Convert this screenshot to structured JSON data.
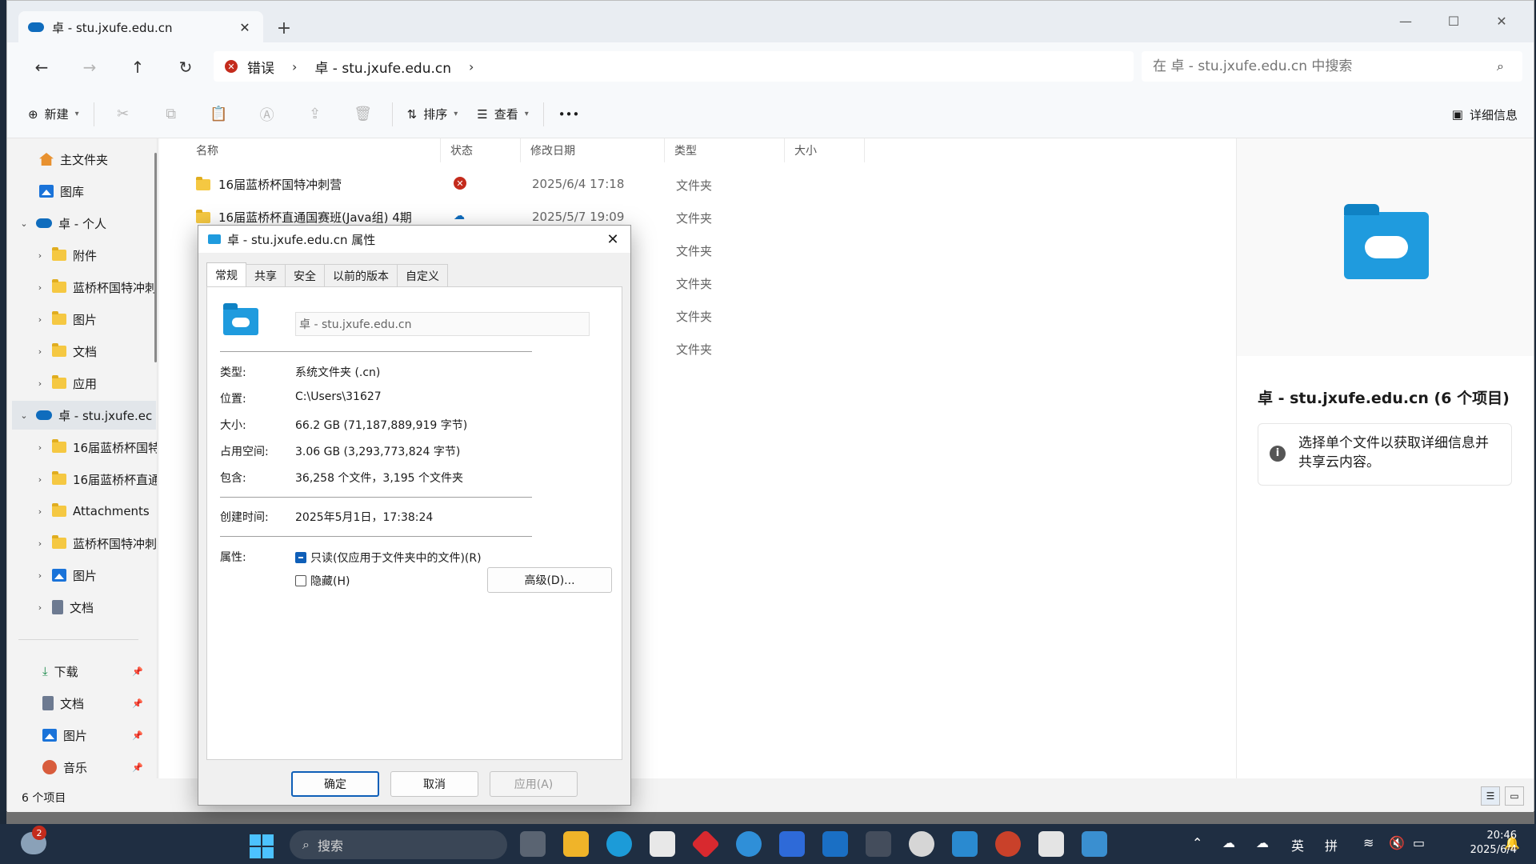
{
  "tab": {
    "title": "卓 - stu.jxufe.edu.cn"
  },
  "address": {
    "error_label": "错误",
    "location": "卓 - stu.jxufe.edu.cn"
  },
  "search": {
    "placeholder": "在 卓 - stu.jxufe.edu.cn 中搜索"
  },
  "toolbar": {
    "new_label": "新建",
    "sort_label": "排序",
    "view_label": "查看",
    "more_label": "•••",
    "details_label": "详细信息"
  },
  "sidebar": {
    "home": "主文件夹",
    "gallery": "图库",
    "personal": "卓 - 个人",
    "personal_children": [
      "附件",
      "蓝桥杯国特冲刺",
      "图片",
      "文档",
      "应用"
    ],
    "org": "卓 - stu.jxufe.ec",
    "org_children": [
      "16届蓝桥杯国特",
      "16届蓝桥杯直通",
      "Attachments",
      "蓝桥杯国特冲刺",
      "图片",
      "文档"
    ],
    "quick": [
      "下载",
      "文档",
      "图片",
      "音乐"
    ]
  },
  "columns": {
    "name": "名称",
    "status": "状态",
    "modified": "修改日期",
    "type": "类型",
    "size": "大小"
  },
  "files": [
    {
      "name": "16届蓝桥杯国特冲刺营",
      "status": "error",
      "date": "2025/6/4 17:18",
      "type": "文件夹"
    },
    {
      "name": "16届蓝桥杯直通国赛班(Java组)  4期",
      "status": "cloud",
      "date": "2025/5/7 19:09",
      "type": "文件夹"
    },
    {
      "name": "",
      "status": "",
      "date": "",
      "type": "文件夹"
    },
    {
      "name": "",
      "status": "",
      "date": "",
      "type": "文件夹"
    },
    {
      "name": "",
      "status": "",
      "date": "",
      "type": "文件夹"
    },
    {
      "name": "",
      "status": "",
      "date": "",
      "type": "文件夹"
    }
  ],
  "details_pane": {
    "title": "卓 - stu.jxufe.edu.cn (6 个项目)",
    "info": "选择单个文件以获取详细信息并共享云内容。"
  },
  "statusbar": {
    "count": "6 个项目"
  },
  "dialog": {
    "title": "卓 - stu.jxufe.edu.cn 属性",
    "tabs": [
      "常规",
      "共享",
      "安全",
      "以前的版本",
      "自定义"
    ],
    "name_value": "卓 - stu.jxufe.edu.cn",
    "type_label": "类型:",
    "type_value": "系统文件夹 (.cn)",
    "location_label": "位置:",
    "location_value": "C:\\Users\\31627",
    "size_label": "大小:",
    "size_value": "66.2 GB (71,187,889,919 字节)",
    "disk_label": "占用空间:",
    "disk_value": "3.06 GB (3,293,773,824 字节)",
    "contains_label": "包含:",
    "contains_value": "36,258 个文件，3,195 个文件夹",
    "created_label": "创建时间:",
    "created_value": "2025年5月1日，17:38:24",
    "attr_label": "属性:",
    "readonly_label": "只读(仅应用于文件夹中的文件)(R)",
    "hidden_label": "隐藏(H)",
    "advanced_label": "高级(D)...",
    "ok_label": "确定",
    "cancel_label": "取消",
    "apply_label": "应用(A)"
  },
  "taskbar": {
    "search_label": "搜索",
    "weather_badge": "2",
    "ime_lang": "英",
    "ime_mode": "拼",
    "time": "20:46",
    "date": "2025/6/4"
  }
}
